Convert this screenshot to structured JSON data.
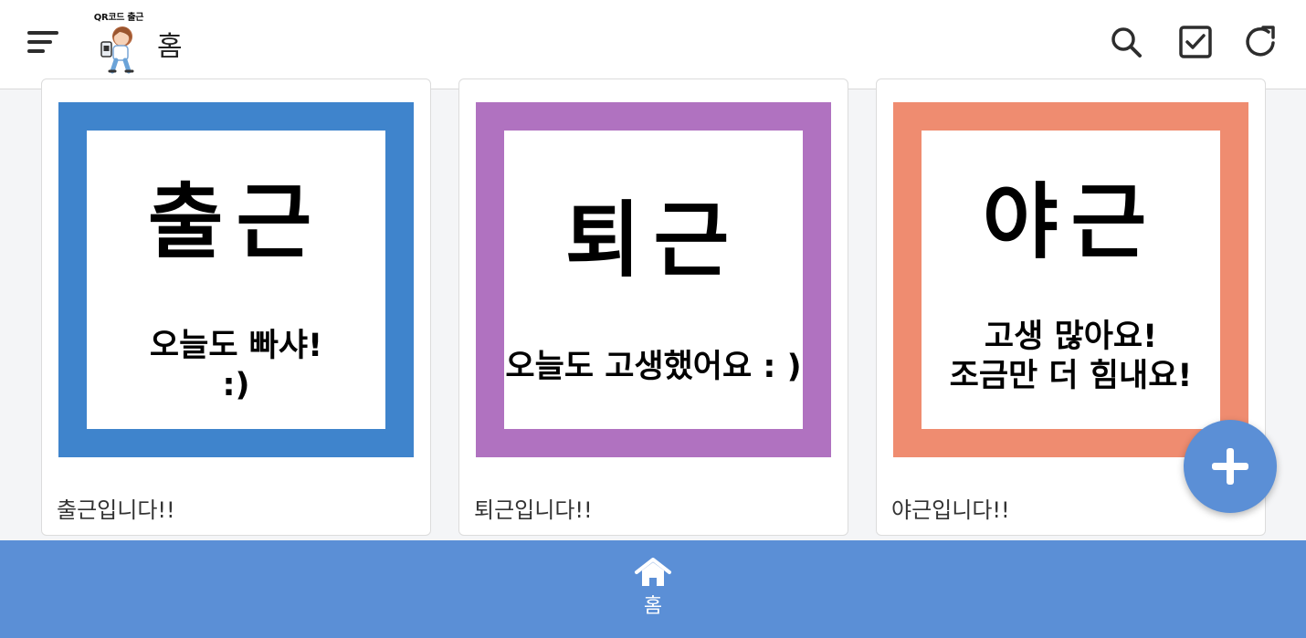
{
  "header": {
    "logo_text": "QR코드 출근",
    "title": "홈"
  },
  "cards": [
    {
      "main_text": "출근",
      "sub_text": "오늘도 빠샤!\n:)",
      "caption": "출근입니다!!",
      "frame_color": "#3f84cc"
    },
    {
      "main_text": "퇴근",
      "sub_text": "오늘도 고생했어요 : )",
      "caption": "퇴근입니다!!",
      "frame_color": "#b072c0"
    },
    {
      "main_text": "야근",
      "sub_text": "고생 많아요!\n조금만 더 힘내요!",
      "caption": "야근입니다!!",
      "frame_color": "#ef8c70"
    }
  ],
  "bottom_nav": {
    "home_label": "홈"
  },
  "icons": {
    "menu": "menu-icon",
    "search": "search-icon",
    "checklist": "checkbox-icon",
    "refresh": "refresh-icon",
    "add": "plus-icon",
    "home": "home-icon"
  },
  "colors": {
    "accent": "#5b8fd6",
    "background": "#f4f5f7"
  }
}
